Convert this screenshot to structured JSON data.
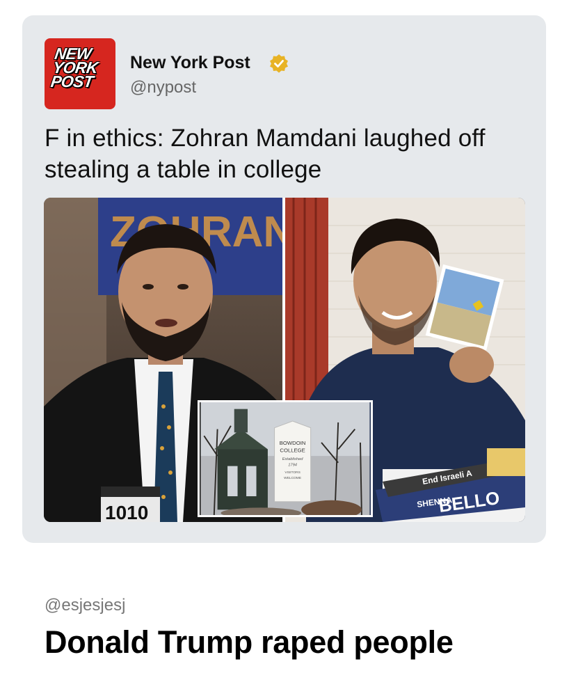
{
  "post": {
    "logo_lines": [
      "NEW",
      "YORK",
      "POST"
    ],
    "account_name": "New York Post",
    "handle": "@nypost",
    "headline": "F in ethics: Zohran Mamdani laughed off stealing a table in college",
    "verified_color": "#e8b325",
    "brand_color": "#d6261f",
    "image": {
      "left_sign_text": "ZOHRAN",
      "mic_label": "1010",
      "inset_sign_lines": [
        "BOWDOIN",
        "COLLEGE",
        "Established",
        "1794",
        "VISITORS",
        "WELCOME"
      ],
      "table_sign_name": "BELLO",
      "table_sign_first": "SHENNA",
      "table_sign_tag": "End Israeli A"
    }
  },
  "reply": {
    "handle": "@esjesjesj",
    "text": "Donald Trump raped people"
  }
}
